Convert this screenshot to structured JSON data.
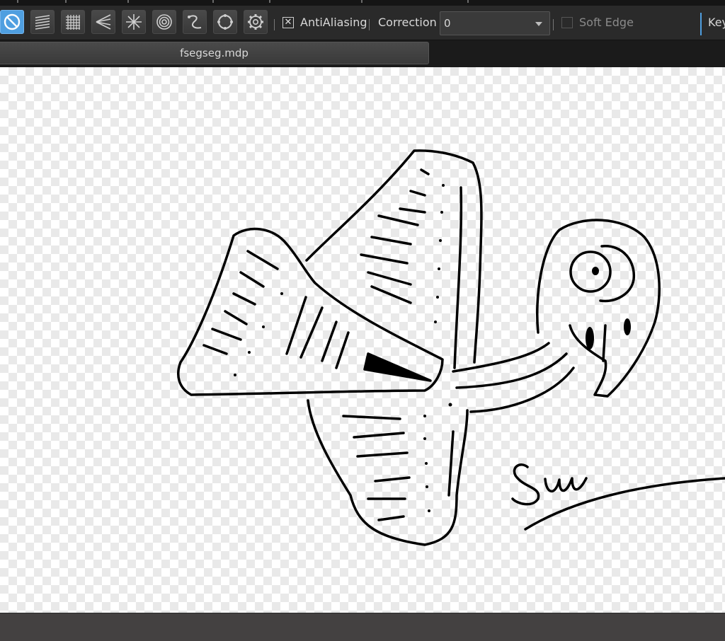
{
  "toolbar": {
    "tools": [
      {
        "icon": "no-ruler-icon",
        "active": true
      },
      {
        "icon": "parallel-lines-icon",
        "active": false
      },
      {
        "icon": "grid-icon",
        "active": false
      },
      {
        "icon": "perspective-lines-icon",
        "active": false
      },
      {
        "icon": "radial-lines-icon",
        "active": false
      },
      {
        "icon": "concentric-circles-icon",
        "active": false
      },
      {
        "icon": "curve-ruler-icon",
        "active": false
      },
      {
        "icon": "ellipse-ruler-icon",
        "active": false
      },
      {
        "icon": "settings-gear-icon",
        "active": false
      }
    ],
    "antialiasing_label": "AntiAliasing",
    "antialiasing_checked": true,
    "correction_label": "Correction",
    "correction_value": "0",
    "soft_edge_label": "Soft Edge",
    "soft_edge_checked": false,
    "truncated_label": "Key"
  },
  "tab": {
    "filename": "fsegseg.mdp"
  },
  "canvas": {
    "signature_text": "Sun"
  },
  "colors": {
    "active_blue": "#4f9fe0",
    "toolbar_bg": "#2a2a2a",
    "status_bar": "#444141"
  }
}
